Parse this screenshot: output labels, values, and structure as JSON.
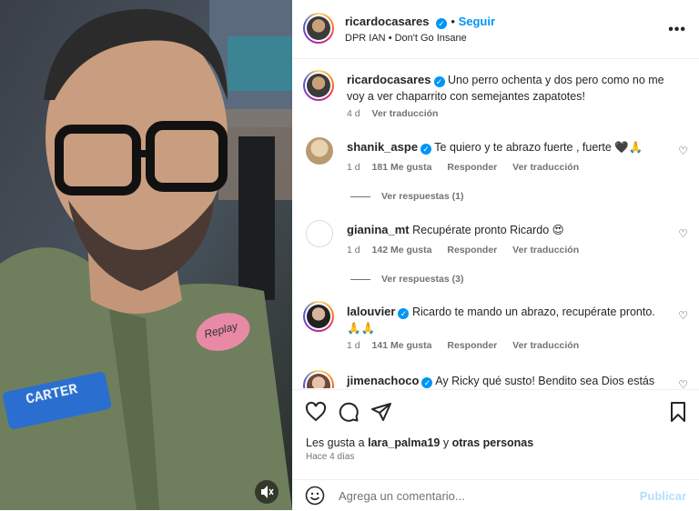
{
  "post": {
    "username": "ricardocasares",
    "follow_label": "Seguir",
    "audio_artist": "DPR IAN",
    "audio_track": "Don't Go Insane",
    "caption": "Uno perro ochenta y dos pero como no me voy a ver chaparrito con semejantes zapatotes!",
    "caption_age": "4 d",
    "see_translation": "Ver traducción"
  },
  "comments": [
    {
      "username": "shanik_aspe",
      "verified": true,
      "text": "Te quiero y te abrazo fuerte , fuerte 🖤🙏",
      "age": "1 d",
      "likes": "181 Me gusta",
      "reply": "Responder",
      "translate": "Ver traducción",
      "replies": "Ver respuestas (1)"
    },
    {
      "username": "gianina_mt",
      "verified": false,
      "text": "Recupérate pronto Ricardo 😍",
      "age": "1 d",
      "likes": "142 Me gusta",
      "reply": "Responder",
      "translate": "Ver traducción",
      "replies": "Ver respuestas (3)"
    },
    {
      "username": "lalouvier",
      "verified": true,
      "text": "Ricardo te mando un abrazo, recupérate pronto. 🙏🙏",
      "age": "1 d",
      "likes": "141 Me gusta",
      "reply": "Responder",
      "translate": "Ver traducción",
      "replies": ""
    },
    {
      "username": "jimenachoco",
      "verified": true,
      "text": "Ay Ricky qué susto! Bendito sea Dios estás",
      "age": "",
      "likes": "",
      "reply": "",
      "translate": "",
      "replies": ""
    }
  ],
  "likes_summary": {
    "prefix": "Les gusta a",
    "user": "lara_palma19",
    "suffix": "y",
    "others": "otras personas"
  },
  "time_ago": "Hace 4 días",
  "composer": {
    "placeholder": "Agrega un comentario...",
    "publish": "Publicar"
  },
  "video": {
    "patch_text": "CARTER",
    "tag_text": "Replay"
  },
  "icons": {
    "like": "heart-icon",
    "comment": "comment-icon",
    "share": "send-icon",
    "save": "bookmark-icon",
    "emoji": "emoji-icon",
    "mute": "speaker-muted-icon",
    "more": "more-options-icon"
  }
}
